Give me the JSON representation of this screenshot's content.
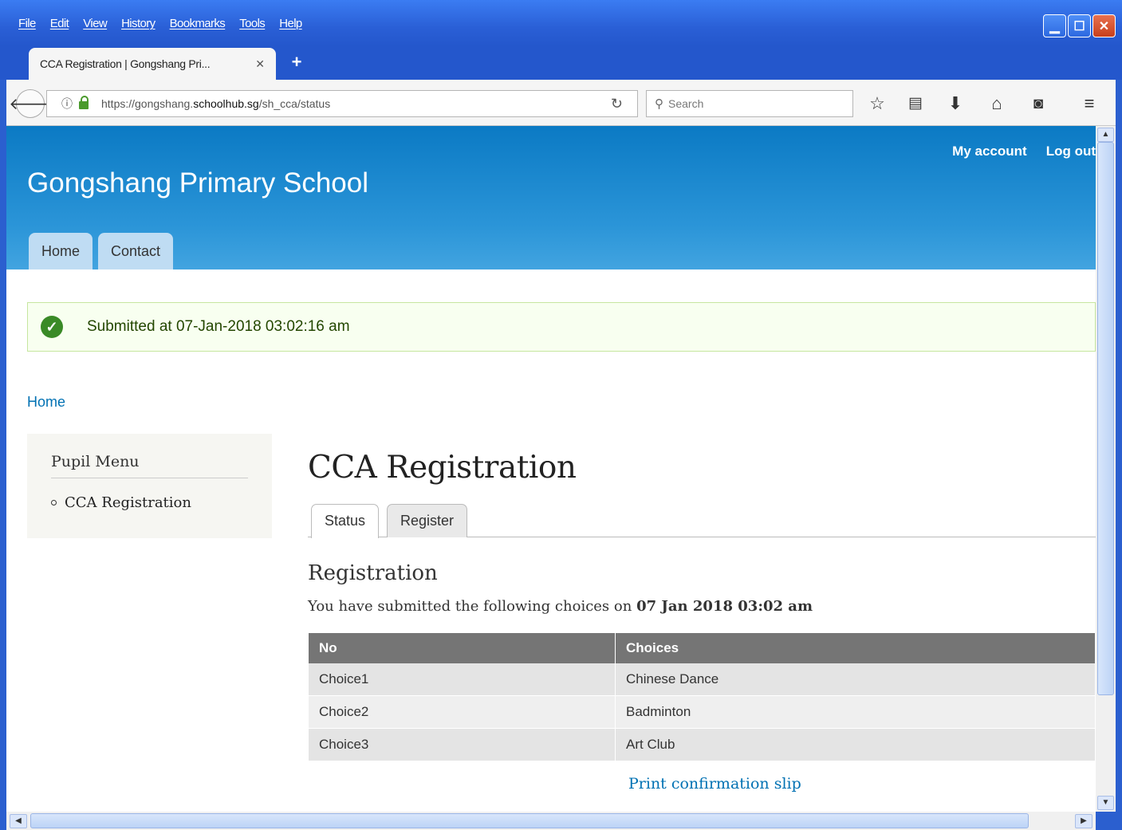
{
  "menubar": [
    "File",
    "Edit",
    "View",
    "History",
    "Bookmarks",
    "Tools",
    "Help"
  ],
  "tab": {
    "title": "CCA Registration | Gongshang Pri...",
    "close": "✕",
    "new_tab": "+"
  },
  "navbar": {
    "url_prefix": "https://gongshang.",
    "url_domain": "schoolhub.sg",
    "url_path": "/sh_cca/status",
    "search_placeholder": "Search"
  },
  "site": {
    "name": "Gongshang Primary School",
    "secondary_menu": [
      "My account",
      "Log out"
    ],
    "primary_tabs": [
      "Home",
      "Contact"
    ]
  },
  "message": "Submitted at 07-Jan-2018 03:02:16 am",
  "breadcrumb": "Home",
  "sidebar": {
    "title": "Pupil Menu",
    "item": "CCA Registration"
  },
  "page": {
    "title": "CCA Registration",
    "tabs": [
      "Status",
      "Register"
    ],
    "heading": "Registration",
    "intro": "You have submitted the following choices on",
    "intro_date": "07 Jan 2018 03:02 am",
    "table": {
      "headers": [
        "No",
        "Choices"
      ],
      "rows": [
        [
          "Choice1",
          "Chinese Dance"
        ],
        [
          "Choice2",
          "Badminton"
        ],
        [
          "Choice3",
          "Art Club"
        ]
      ]
    },
    "print_link": "Print confirmation slip"
  },
  "colors": {
    "header": "#0b7ac4",
    "link": "#0071b3",
    "success": "#3a8a27",
    "table_header": "#757575"
  }
}
